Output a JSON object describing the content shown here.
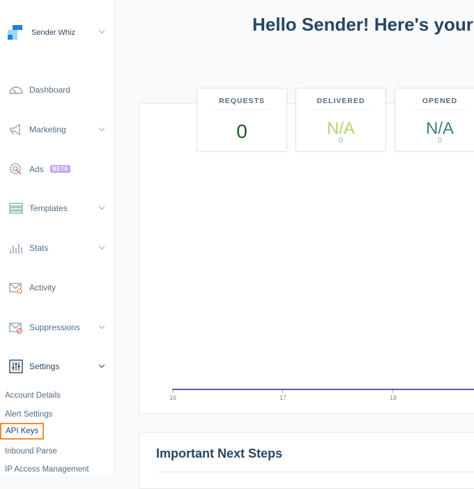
{
  "account": {
    "name": "Sender Whiz"
  },
  "nav": {
    "dashboard": "Dashboard",
    "marketing": "Marketing",
    "ads": "Ads",
    "ads_badge": "BETA",
    "templates": "Templates",
    "stats": "Stats",
    "activity": "Activity",
    "suppressions": "Suppressions",
    "settings": "Settings"
  },
  "settings_sub": {
    "account_details": "Account Details",
    "alert_settings": "Alert Settings",
    "api_keys": "API Keys",
    "inbound_parse": "Inbound Parse",
    "ip_access": "IP Access Management"
  },
  "header": {
    "title": "Hello Sender! Here's your"
  },
  "stats": {
    "requests": {
      "label": "REQUESTS",
      "value": "0",
      "color": "#1a5c1a"
    },
    "delivered": {
      "label": "DELIVERED",
      "value": "N/A",
      "sub": "0",
      "color": "#b2d56c"
    },
    "opened": {
      "label": "OPENED",
      "value": "N/A",
      "sub": "0",
      "color": "#3a7f7f"
    }
  },
  "chart": {
    "x_ticks": [
      "16",
      "17",
      "18"
    ]
  },
  "next_steps": {
    "title": "Important Next Steps"
  },
  "colors": {
    "accent": "#294661",
    "highlight": "#f38b2c",
    "beta": "#c6a6ee",
    "axis": "#5a5aa8"
  }
}
